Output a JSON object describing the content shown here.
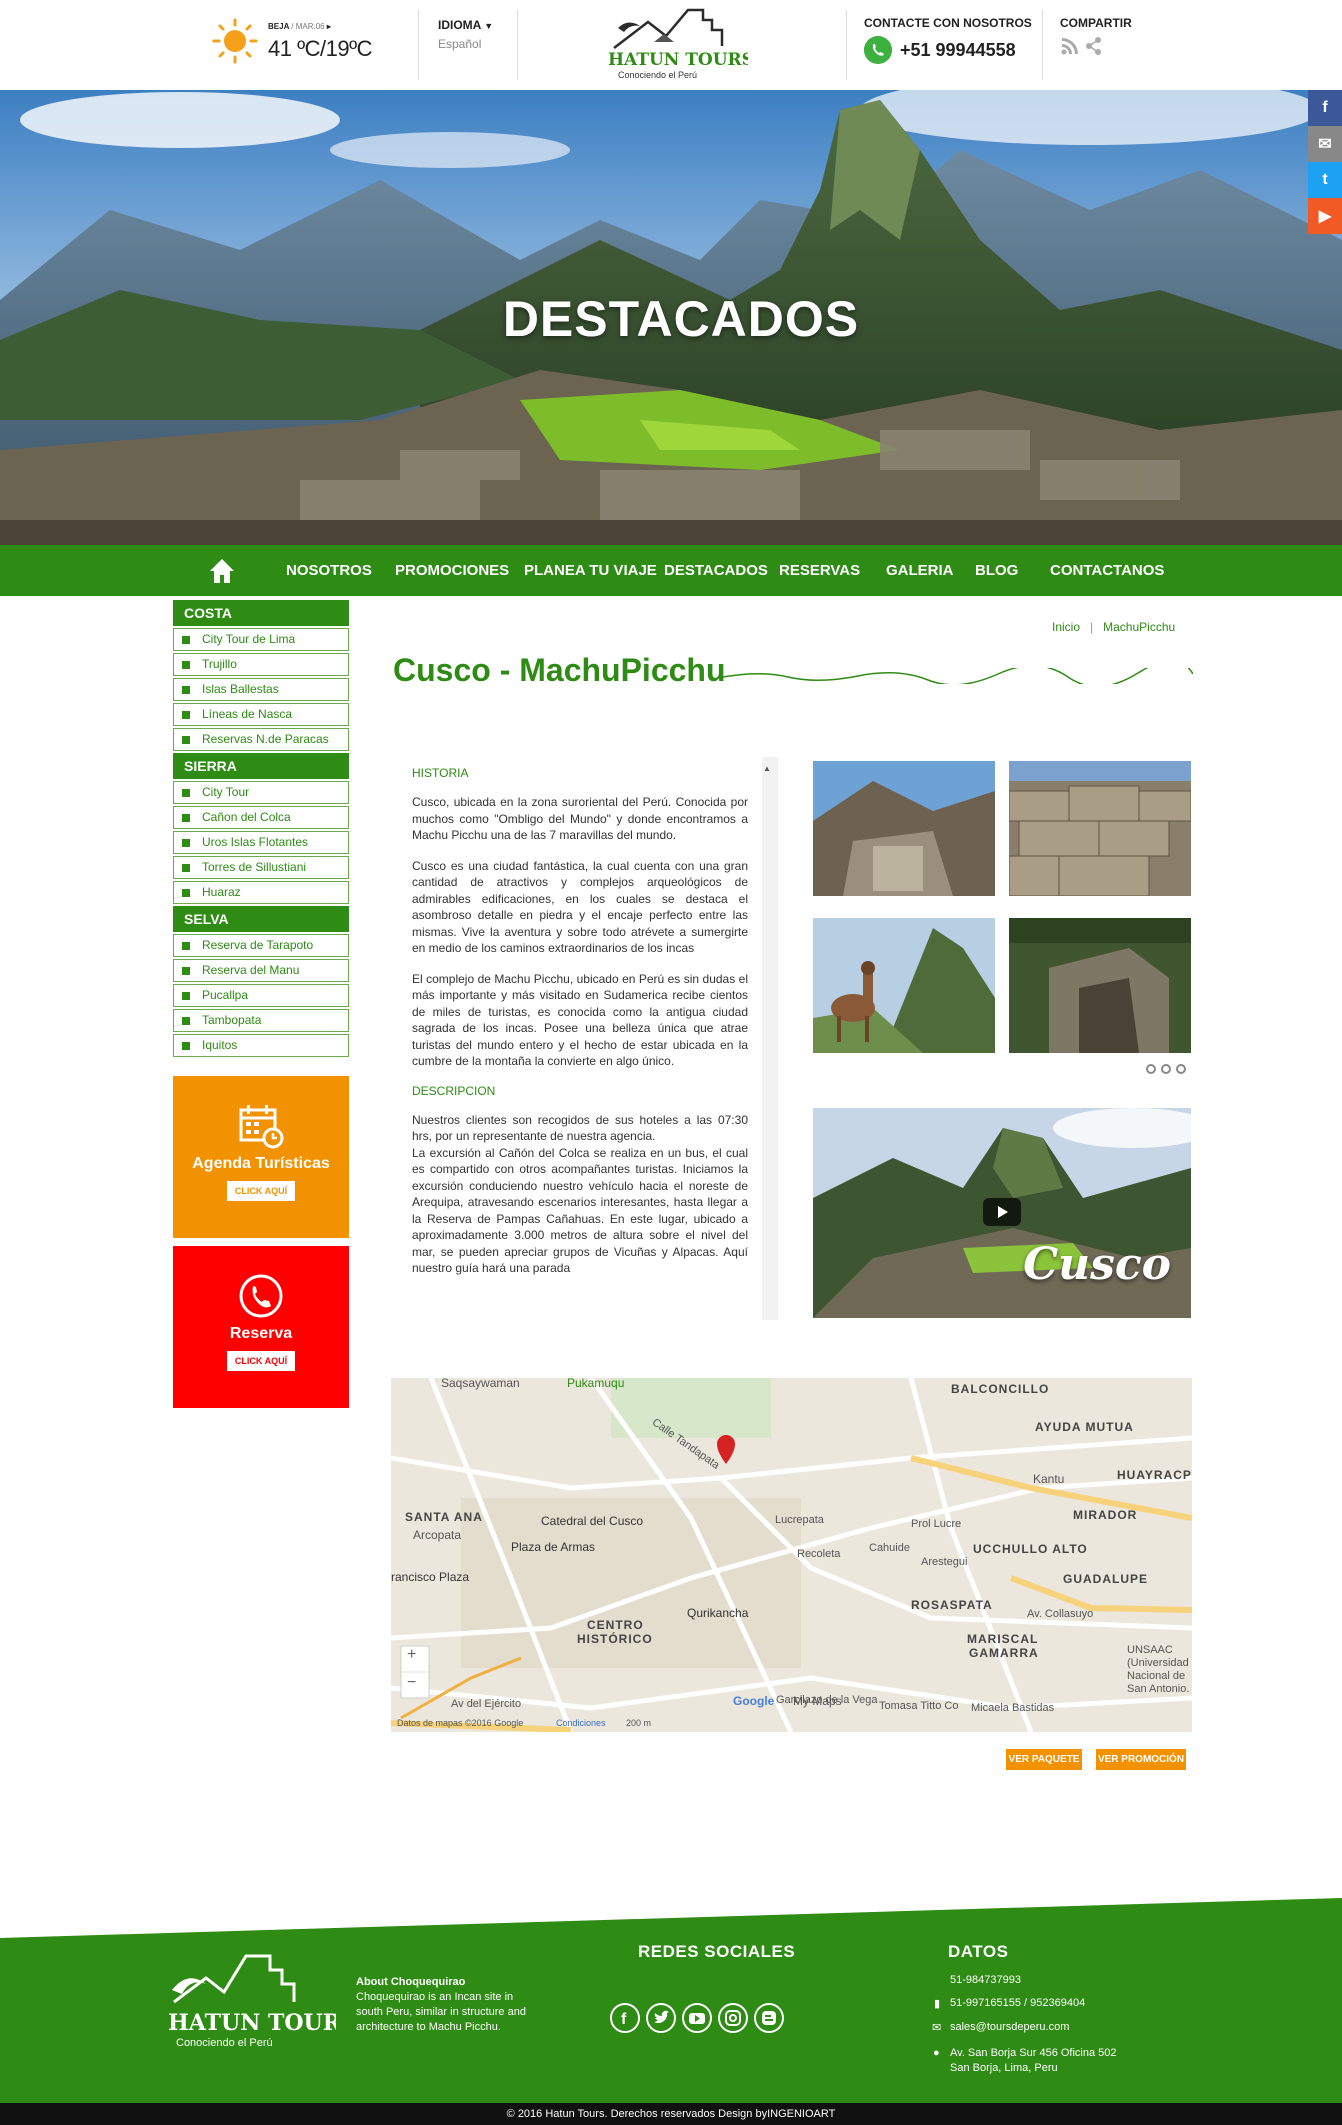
{
  "header": {
    "weather": {
      "city": "BEJA",
      "date": "/ MAR.06",
      "arrow": "▸",
      "temp": "41 ºC/19ºC"
    },
    "language": {
      "title": "IDIOMA",
      "value": "Español"
    },
    "logo": {
      "name": "HATUN TOURS",
      "tagline": "Conociendo el Perú"
    },
    "contact": {
      "title": "CONTACTE CON NOSOTROS",
      "phone": "+51 99944558"
    },
    "share": {
      "title": "COMPARTIR"
    }
  },
  "hero": {
    "title": "DESTACADOS"
  },
  "side_social": [
    "f",
    "✉",
    "t",
    "▶"
  ],
  "nav": {
    "items": [
      "NOSOTROS",
      "PROMOCIONES",
      "PLANEA TU VIAJE",
      "DESTACADOS",
      "RESERVAS",
      "GALERIA",
      "BLOG",
      "CONTACTANOS"
    ]
  },
  "sidebar": {
    "costa": {
      "title": "COSTA",
      "items": [
        "City Tour de Lima",
        "Trujillo",
        "Islas Ballestas",
        "Líneas de Nasca",
        "Reservas N.de Paracas"
      ]
    },
    "sierra": {
      "title": "SIERRA",
      "items": [
        "City Tour",
        "Cañon del Colca",
        "Uros Islas Flotantes",
        "Torres de Sillustiani",
        "Huaraz"
      ]
    },
    "selva": {
      "title": "SELVA",
      "items": [
        "Reserva de Tarapoto",
        "Reserva del Manu",
        "Pucallpa",
        "Tambopata",
        "Iquitos"
      ]
    },
    "agenda": {
      "title": "Agenda Turísticas",
      "button": "CLICK AQUÍ"
    },
    "reserva": {
      "title": "Reserva",
      "button": "CLICK AQUÍ"
    }
  },
  "breadcrumb": {
    "home": "Inicio",
    "sep": "|",
    "current": "MachuPicchu"
  },
  "page_title": "Cusco - MachuPicchu",
  "content": {
    "historia_title": "HISTORIA",
    "p1": "Cusco, ubicada en la zona suroriental del Perú. Conocida por muchos como \"Ombligo del Mundo\" y donde encontramos a Machu Picchu una de las 7 maravillas del mundo.",
    "p2": "Cusco es una ciudad fantástica, la cual cuenta con una gran cantidad de atractivos y complejos arqueológicos de admirables edificaciones, en los cuales se destaca el asombroso detalle en piedra y el encaje perfecto entre las mismas. Vive la aventura y sobre todo atrévete a sumergirte en medio de los caminos extraordinarios de los incas",
    "p3": "El complejo de Machu Picchu, ubicado en Perú es sin dudas el más importante y más visitado en Sudamerica recibe cientos de miles de turistas, es conocida como la antigua ciudad sagrada de los incas. Posee una belleza única que atrae turistas del mundo entero y el hecho de estar ubicada en la cumbre de la montaña la convierte en algo único.",
    "descripcion_title": "DESCRIPCION",
    "p4": "Nuestros clientes son recogidos de sus hoteles a las 07:30 hrs, por un representante de nuestra agencia.",
    "p5": "La excursión al Cañón del Colca se realiza en un bus, el cual es compartido con otros acompañantes turistas. Iniciamos la excursión conduciendo nuestro vehículo hacia el noreste de Arequipa, atravesando escenarios interesantes, hasta llegar a la Reserva de Pampas Cañahuas. En este lugar, ubicado a aproximadamente 3.000 metros de altura sobre el nivel del mar, se pueden apreciar grupos de Vicuñas y Alpacas. Aquí nuestro guía hará una parada"
  },
  "video": {
    "label": "Cusco"
  },
  "map": {
    "labels": [
      "Saqsaywaman",
      "Pukamuqu",
      "BALCONCILLO",
      "AYUDA MUTUA",
      "HUAYRACP",
      "Kantu",
      "MIRADOR",
      "UCCHULLO ALTO",
      "GUADALUPE",
      "SANTA ANA",
      "Arcopata",
      "Catedral del Cusco",
      "Plaza de Armas",
      "rancisco Plaza",
      "CENTRO",
      "HISTÓRICO",
      "Qurikancha",
      "ROSASPATA",
      "MARISCAL",
      "GAMARRA",
      "UNSAAC",
      "(Universidad",
      "Nacional de",
      "San Antonio.",
      "Calle Tandapata",
      "Lucrepata",
      "Prol Lucre",
      "Recoleta",
      "Cahuide",
      "Arestegui",
      "Av. Collasuyo",
      "Av del Ejército",
      "Tomasa Titto Co",
      "Micaela Bastidas",
      "Garcilazo de la Vega",
      "Google",
      "My Maps"
    ],
    "zoom_in": "+",
    "zoom_out": "−",
    "footer": "Datos de mapas ©2016 Google",
    "terms": "Condiciones",
    "scale": "200 m"
  },
  "buttons": {
    "paquete": "VER PAQUETE",
    "promocion": "VER PROMOCIÓN"
  },
  "footer": {
    "logo_name": "HATUN TOURS",
    "logo_tagline": "Conociendo el Perú",
    "about_title": "About Choquequirao",
    "about_1": "Choquequirao is an Incan site in",
    "about_2": "south Peru, similar in structure and",
    "about_3": "architecture to Machu Picchu.",
    "social_title": "REDES SOCIALES",
    "datos_title": "DATOS",
    "phone1": "51-984737993",
    "phone2": "51-997165155 / 952369404",
    "email": "sales@toursdeperu.com",
    "address1": "Av. San Borja Sur 456 Oficina 502",
    "address2": "San Borja, Lima, Peru",
    "copyright": "© 2016  Hatun Tours. Derechos reservados Design byINGENIOART"
  },
  "colors": {
    "green": "#2e8b14",
    "orange": "#f39200",
    "red": "#ff0000"
  }
}
